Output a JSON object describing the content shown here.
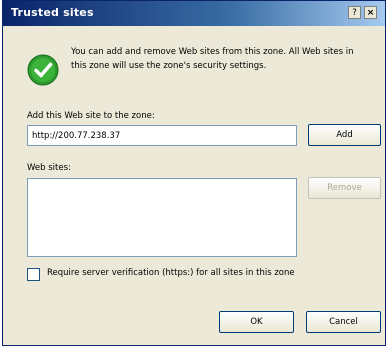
{
  "window": {
    "title": "Trusted sites",
    "help_glyph": "?",
    "close_glyph": "×"
  },
  "info": {
    "text": "You can add and remove Web sites from this zone. All Web sites in this zone will use the zone's security settings.",
    "icon": "check-icon"
  },
  "add_section": {
    "label": "Add this Web site to the zone:",
    "url_value": "http://200.77.238.37",
    "add_label": "Add"
  },
  "sites_section": {
    "label": "Web sites:",
    "sites": [],
    "remove_label": "Remove"
  },
  "verification": {
    "label": "Require server verification (https:) for all sites in this zone",
    "checked": false
  },
  "footer": {
    "ok_label": "OK",
    "cancel_label": "Cancel"
  },
  "colors": {
    "titlebar": "#0a246a",
    "dialog_bg": "#ece9d8",
    "check_green": "#2e9b2e"
  }
}
